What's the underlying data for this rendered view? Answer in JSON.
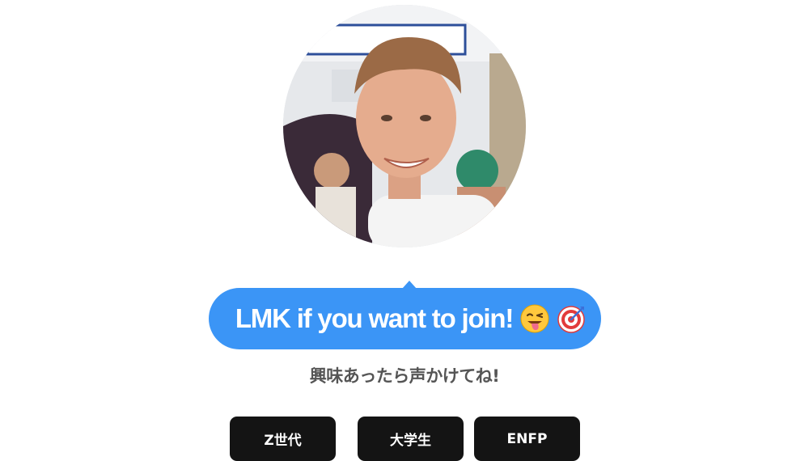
{
  "profile": {
    "avatar_icon": "profile-photo"
  },
  "bubble": {
    "text": "LMK if you want to join!",
    "emojis": [
      "winking-face-with-tongue",
      "direct-hit-target"
    ],
    "color": "#3b95f6"
  },
  "subtitle": "興味あったら声かけてね!",
  "tags": [
    {
      "label": "Z世代"
    },
    {
      "label": "大学生"
    },
    {
      "label": "ENFP"
    }
  ]
}
